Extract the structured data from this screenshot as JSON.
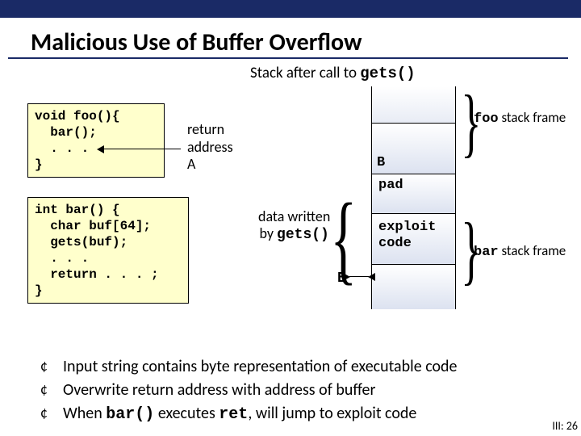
{
  "title": "Malicious Use of Buffer Overflow",
  "subtitle_pre": "Stack after call to ",
  "subtitle_code": "gets()",
  "code_foo": "void foo(){\n  bar();\n  . . .\n}",
  "code_bar": "int bar() {\n  char buf[64];\n  gets(buf);\n  . . .\n  return . . . ;\n}",
  "return_addr": "return\naddress\nA",
  "data_written_pre": "data written\nby ",
  "data_written_code": "gets()",
  "stack": {
    "b_label_top": "B",
    "pad": "pad",
    "exploit": "exploit\ncode",
    "b_label_left": "B"
  },
  "foo_frame_code": "foo",
  "foo_frame_text": " stack frame",
  "bar_frame_code": "bar",
  "bar_frame_text": " stack frame",
  "bullets": {
    "b1": "Input string contains byte representation of executable code",
    "b2": "Overwrite return address with address of buffer",
    "b3_pre": "When ",
    "b3_c1": "bar()",
    "b3_mid": " executes ",
    "b3_c2": "ret",
    "b3_post": ", will jump to exploit code"
  },
  "slide_num": "III: 26"
}
